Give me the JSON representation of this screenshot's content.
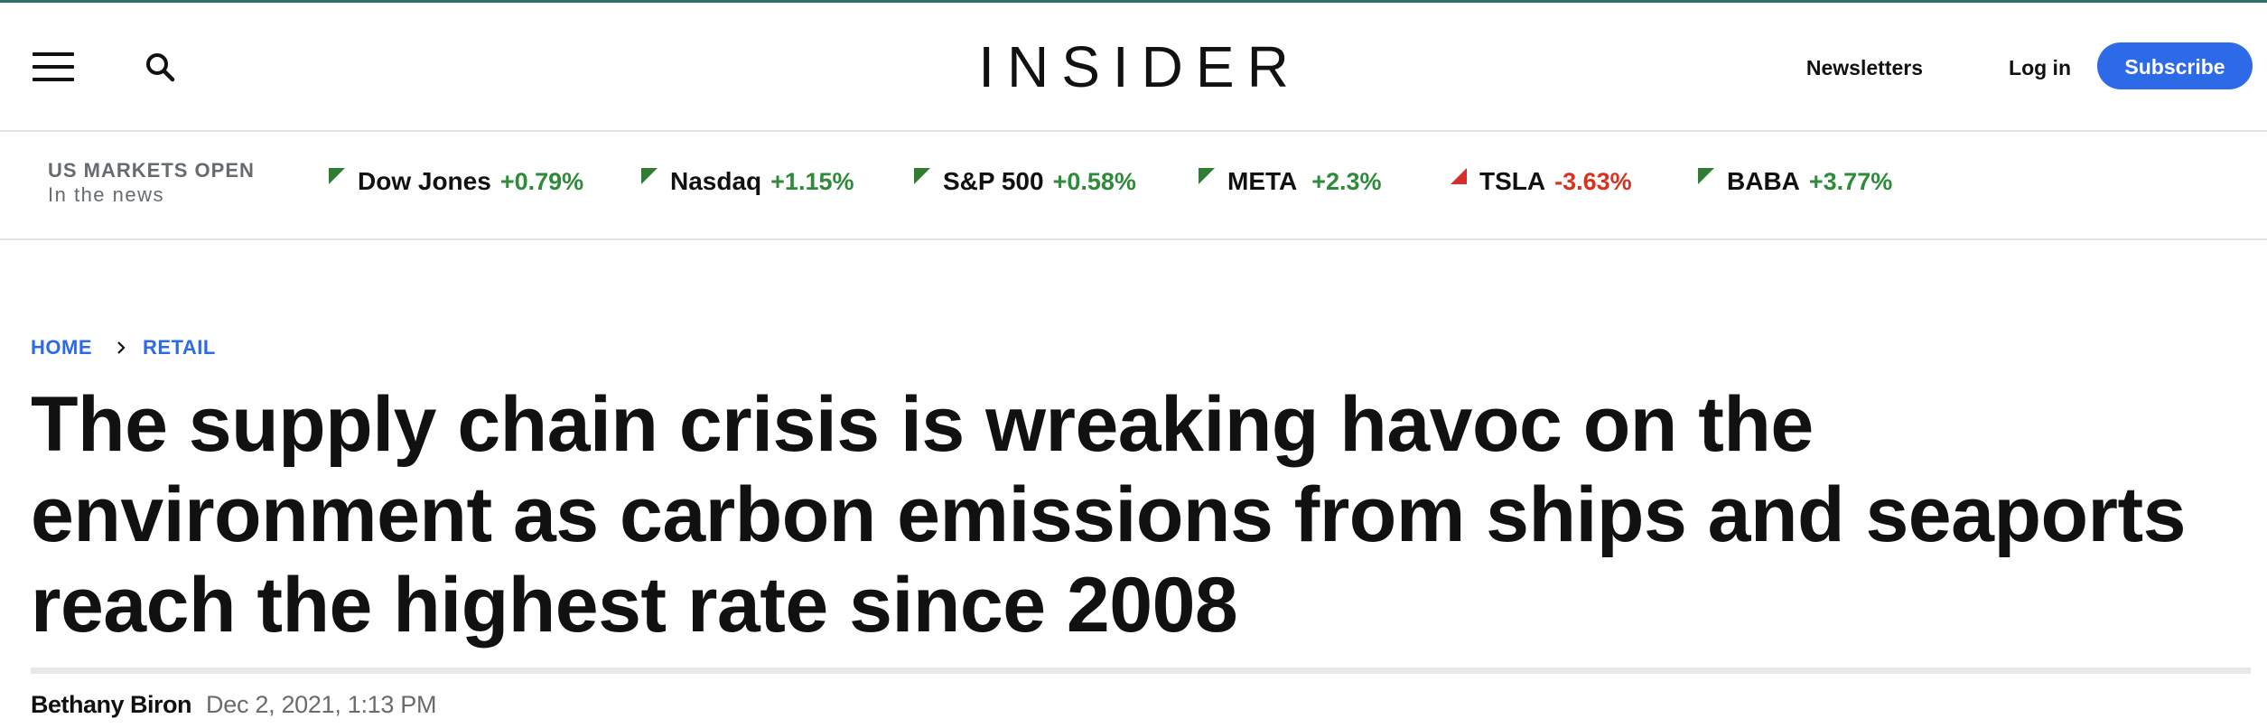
{
  "header": {
    "logo": "INSIDER",
    "menu_icon": "hamburger-menu-icon",
    "search_icon": "search-icon",
    "newsletters_label": "Newsletters",
    "login_label": "Log in",
    "subscribe_label": "Subscribe",
    "subscribe_color": "#2d6ae8"
  },
  "markets": {
    "status": "US MARKETS OPEN",
    "subtitle": "In the news",
    "tickers": [
      {
        "name": "Dow Jones",
        "change": "+0.79%",
        "direction": "positive"
      },
      {
        "name": "Nasdaq",
        "change": "+1.15%",
        "direction": "positive"
      },
      {
        "name": "S&P 500",
        "change": "+0.58%",
        "direction": "positive"
      },
      {
        "name": "META",
        "change": "+2.3%",
        "direction": "positive"
      },
      {
        "name": "TSLA",
        "change": "-3.63%",
        "direction": "negative"
      },
      {
        "name": "BABA",
        "change": "+3.77%",
        "direction": "positive"
      }
    ],
    "positive_color": "#2e8b3a",
    "negative_color": "#d8321e"
  },
  "breadcrumb": {
    "items": [
      "HOME",
      "RETAIL"
    ],
    "separator_icon": "chevron-right-icon"
  },
  "article": {
    "headline": "The supply chain crisis is wreaking havoc on the environment as carbon emissions from ships and seaports reach the highest rate since 2008",
    "author": "Bethany Biron",
    "date": "Dec 2, 2021, 1:13 PM"
  }
}
